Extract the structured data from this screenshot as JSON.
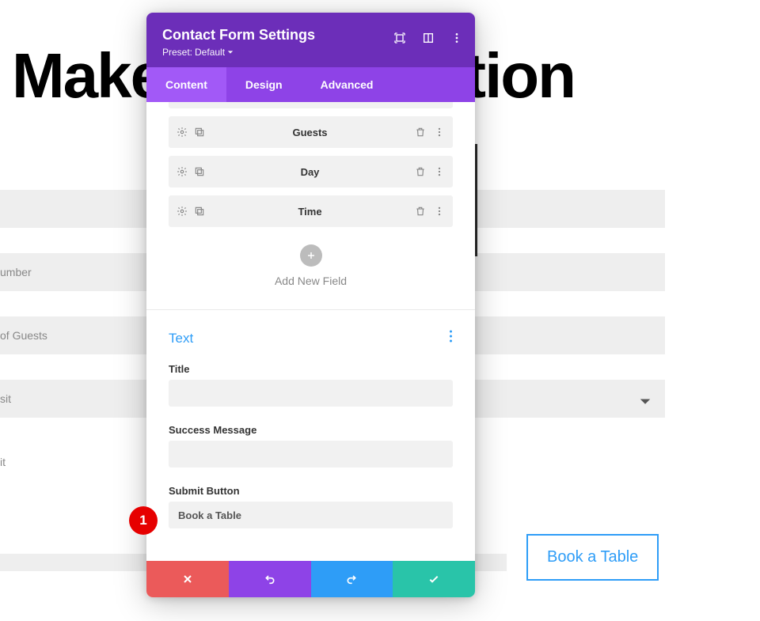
{
  "background": {
    "heading": "Make a Reservation",
    "fields": {
      "number_label": "umber",
      "guests_label": "of Guests",
      "sit_label": "sit",
      "it_label": "it"
    },
    "book_button": "Book a Table"
  },
  "modal": {
    "title": "Contact Form Settings",
    "preset_prefix": "Preset:",
    "preset_value": "Default",
    "tabs": {
      "content": "Content",
      "design": "Design",
      "advanced": "Advanced"
    },
    "fields": [
      {
        "label": "Guests"
      },
      {
        "label": "Day"
      },
      {
        "label": "Time"
      }
    ],
    "add_new_field": "Add New Field",
    "text_section": {
      "title": "Text",
      "title_label": "Title",
      "title_value": "",
      "success_label": "Success Message",
      "success_value": "",
      "submit_label": "Submit Button",
      "submit_value": "Book a Table"
    }
  },
  "annotation": {
    "badge_1": "1"
  }
}
